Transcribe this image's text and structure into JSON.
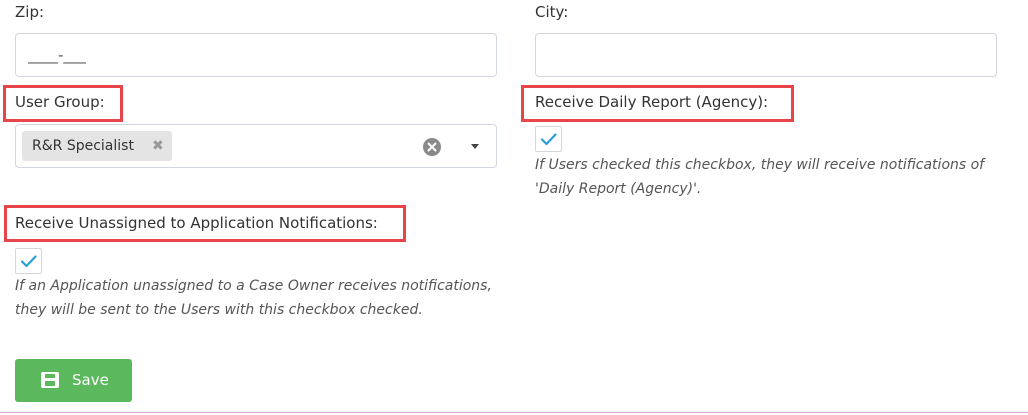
{
  "zip": {
    "label": "Zip:",
    "value": "____-___"
  },
  "city": {
    "label": "City:",
    "value": ""
  },
  "user_group": {
    "label": "User Group:",
    "selected": [
      "R&R Specialist"
    ],
    "remove_glyph": "✖"
  },
  "daily_report": {
    "label": "Receive Daily Report (Agency):",
    "checked": true,
    "help": "If Users checked this checkbox, they will receive notifications of 'Daily Report (Agency)'."
  },
  "unassigned_notifications": {
    "label": "Receive Unassigned to Application Notifications:",
    "checked": true,
    "help": "If an Application unassigned to a Case Owner receives notifications, they will be sent to the Users with this checkbox checked."
  },
  "save_button": {
    "label": "Save",
    "icon": "save-icon"
  },
  "colors": {
    "highlight": "#e8454b",
    "checkmark": "#2a9fd6",
    "save_bg": "#5cb85c",
    "divider": "#d9a7d9"
  }
}
